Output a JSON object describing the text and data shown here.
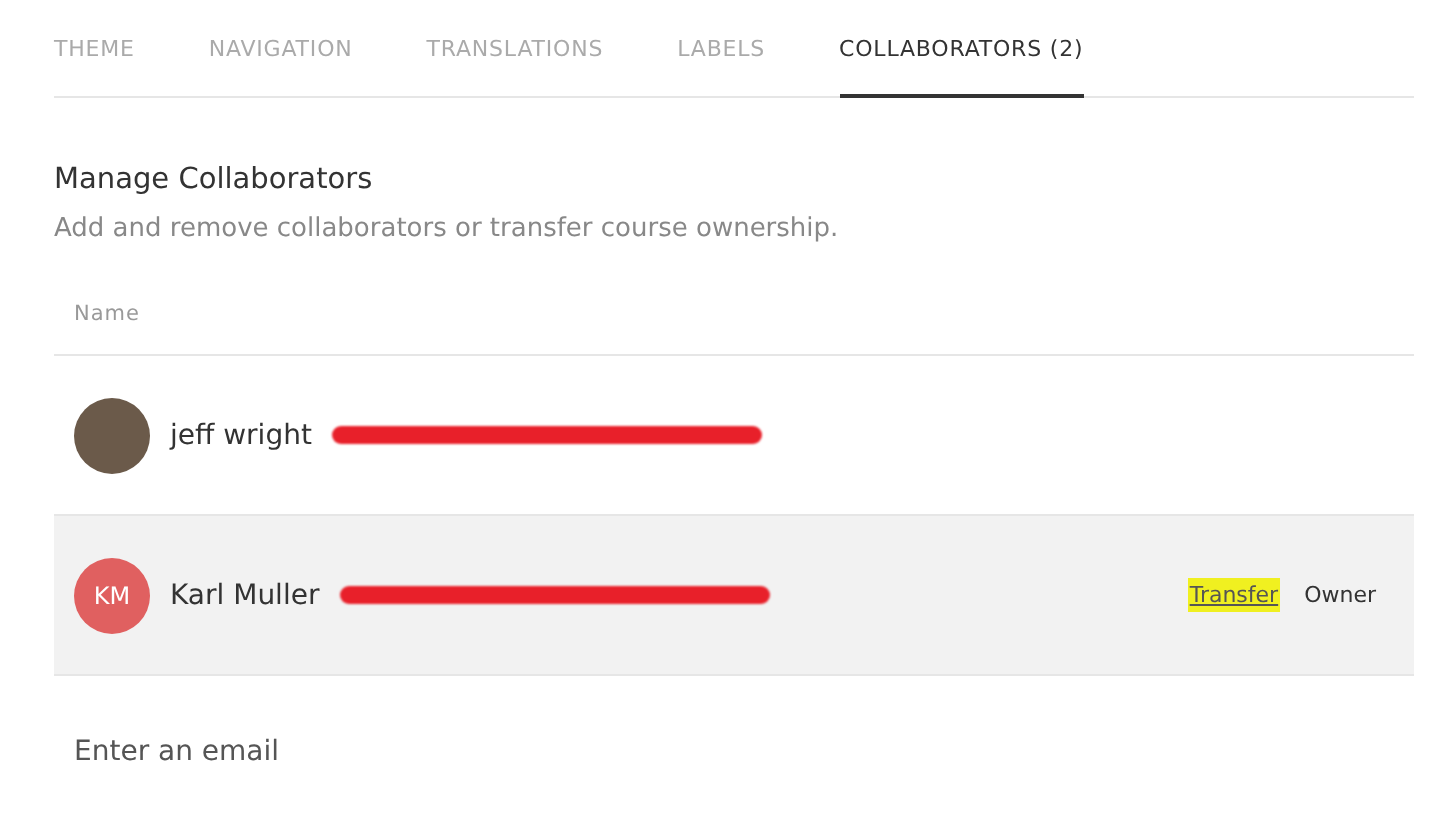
{
  "tabs": [
    {
      "label": "THEME",
      "selected": false
    },
    {
      "label": "NAVIGATION",
      "selected": false
    },
    {
      "label": "TRANSLATIONS",
      "selected": false
    },
    {
      "label": "LABELS",
      "selected": false
    },
    {
      "label": "COLLABORATORS (2)",
      "selected": true
    }
  ],
  "section": {
    "title": "Manage Collaborators",
    "description": "Add and remove collaborators or transfer course ownership."
  },
  "table": {
    "columns": [
      "Name"
    ],
    "rows": [
      {
        "avatar": {
          "kind": "photo"
        },
        "name": "jeff wright",
        "email_redacted": true,
        "selected": false
      },
      {
        "avatar": {
          "kind": "initials",
          "initials": "KM"
        },
        "name": "Karl Muller",
        "email_redacted": true,
        "selected": true,
        "action": {
          "label": "Transfer",
          "highlighted": true
        },
        "role": "Owner"
      }
    ]
  },
  "email_field": {
    "placeholder": "Enter an email"
  }
}
